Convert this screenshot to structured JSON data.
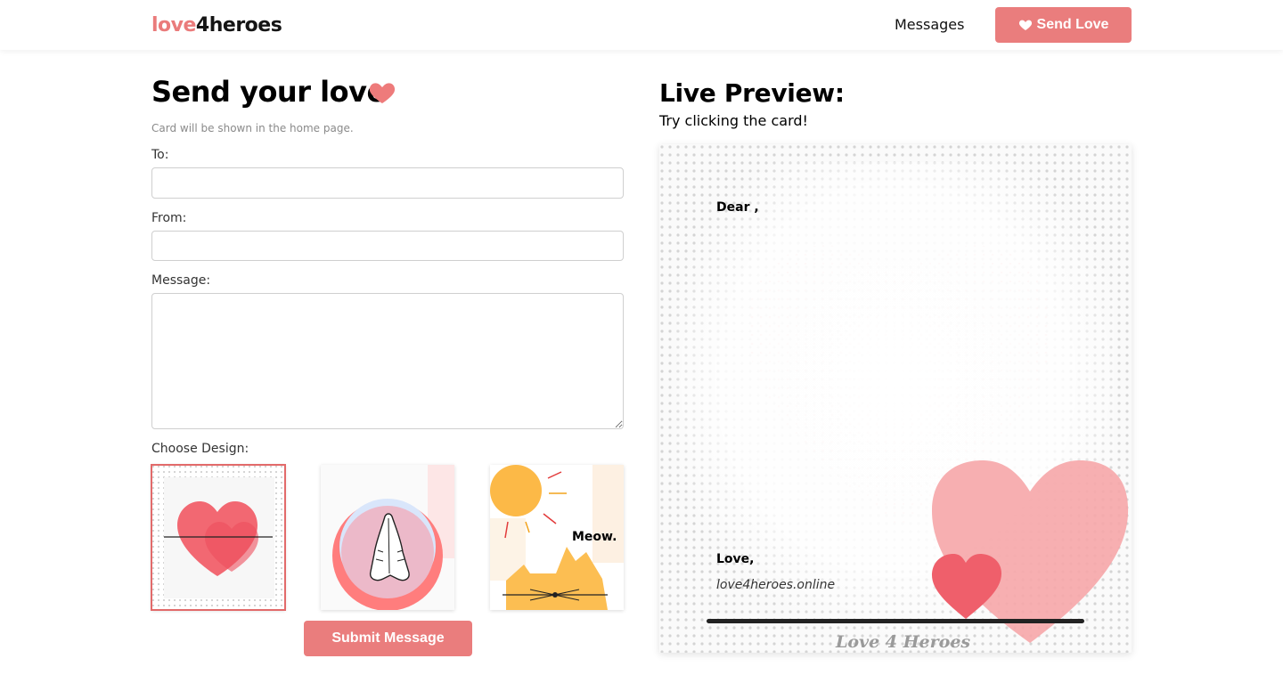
{
  "nav": {
    "brand_part1": "love",
    "brand_part2": "4heroes",
    "messages_link": "Messages",
    "send_love_button": "Send Love"
  },
  "form": {
    "title": "Send your love",
    "hint": "Card will be shown in the home page.",
    "to_label": "To:",
    "to_value": "",
    "from_label": "From:",
    "from_value": "",
    "message_label": "Message:",
    "message_value": "",
    "design_label": "Choose Design:",
    "designs": [
      {
        "icon": "hearts-design",
        "selected": true
      },
      {
        "icon": "praying-hands-design",
        "selected": false
      },
      {
        "icon": "cat-sun-design",
        "text": "Meow.",
        "selected": false
      }
    ],
    "submit_button": "Submit Message"
  },
  "preview": {
    "title": "Live Preview:",
    "subtitle": "Try clicking the card!",
    "card": {
      "greeting": "Dear ,",
      "closing": "Love,",
      "site": "love4heroes.online",
      "signature": "Love 4 Heroes"
    }
  },
  "colors": {
    "accent": "#ea7d7d",
    "heart": "#ee7b7b"
  }
}
